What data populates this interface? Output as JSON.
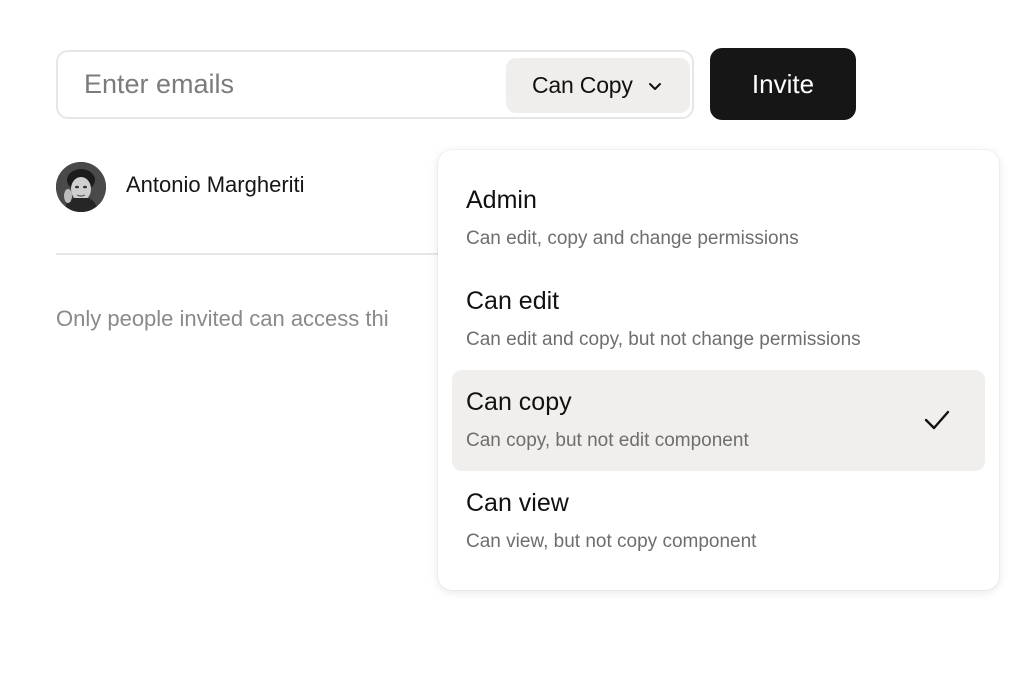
{
  "invite": {
    "email_placeholder": "Enter emails",
    "permission_selected": "Can Copy",
    "invite_label": "Invite"
  },
  "members": [
    {
      "name": "Antonio Margheriti"
    }
  ],
  "access_note": "Only people invited can access thi",
  "dropdown": {
    "options": [
      {
        "title": "Admin",
        "description": "Can edit, copy and change permissions",
        "selected": false
      },
      {
        "title": "Can edit",
        "description": "Can edit and copy, but not change permissions",
        "selected": false
      },
      {
        "title": "Can copy",
        "description": "Can copy, but not edit component",
        "selected": true
      },
      {
        "title": "Can view",
        "description": "Can view, but not copy component",
        "selected": false
      }
    ]
  },
  "icons": {
    "select_chevron": "chevron-down-icon",
    "selected_marker": "checkmark-icon",
    "avatar": "user-photo"
  },
  "colors": {
    "primary_button": "#161616",
    "selected_option_bg": "#efeeec",
    "muted_text": "#8a8a8a"
  }
}
